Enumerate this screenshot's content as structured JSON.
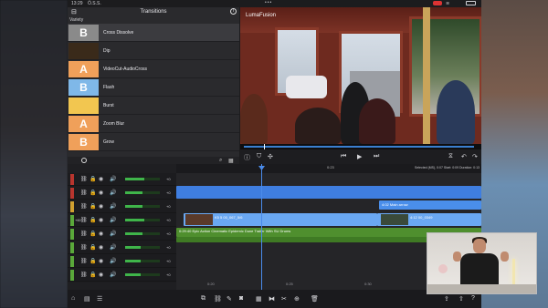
{
  "statusbar": {
    "time": "13:29",
    "signal": "Ö.S.S."
  },
  "transitions": {
    "title": "Transitions",
    "subtitle": "Variety",
    "items": [
      {
        "label": "Cross Dissolve",
        "thumb": "B",
        "color": "#8a8a8a",
        "selected": true
      },
      {
        "label": "Dip",
        "thumb": "",
        "color": "#3a2a1a",
        "selected": false
      },
      {
        "label": "VideoCut-AudioCross",
        "thumb": "A",
        "color": "#f0a05a",
        "selected": false
      },
      {
        "label": "Flash",
        "thumb": "B",
        "color": "#7fb8e8",
        "selected": false
      },
      {
        "label": "Burst",
        "thumb": "",
        "color": "#f2c650",
        "selected": false
      },
      {
        "label": "Zoom Blur",
        "thumb": "A",
        "color": "#f0a05a",
        "selected": false
      },
      {
        "label": "Grow",
        "thumb": "B",
        "color": "#f0a05a",
        "selected": false
      }
    ]
  },
  "viewer": {
    "logo": "LumaFusion"
  },
  "timeline": {
    "timecode": "0:23",
    "selection_info": "Selected (MS), 0:07 Start: 0:09 Duration: 0:13",
    "tracks": [
      {
        "num": "",
        "db": "+0",
        "color": "#b8352e",
        "level": 0.55
      },
      {
        "num": "",
        "db": "+0",
        "color": "#b8352e",
        "level": 0.5
      },
      {
        "num": "",
        "db": "+0",
        "color": "#d0a030",
        "level": 0.5
      },
      {
        "num": "+60",
        "db": "+0",
        "color": "#5aa83a",
        "level": 0.55
      },
      {
        "num": "",
        "db": "+0",
        "color": "#5aa83a",
        "level": 0.5
      },
      {
        "num": "",
        "db": "+0",
        "color": "#5aa83a",
        "level": 0.45
      },
      {
        "num": "",
        "db": "+0",
        "color": "#5aa83a",
        "level": 0.45
      },
      {
        "num": "",
        "db": "+0",
        "color": "#5aa83a",
        "level": 0.45
      }
    ],
    "clips": {
      "title_clip": "4:02 Main arrow",
      "video_a": "K5 5 00_067_5/6",
      "video_b": "4:12 00_0349",
      "audio": "0:29:40 Epic Action Cinematic Epidemic Dune Trailer With SU Drums"
    },
    "ticks": [
      "0:20",
      "0:25",
      "0:30",
      "0:35"
    ]
  }
}
